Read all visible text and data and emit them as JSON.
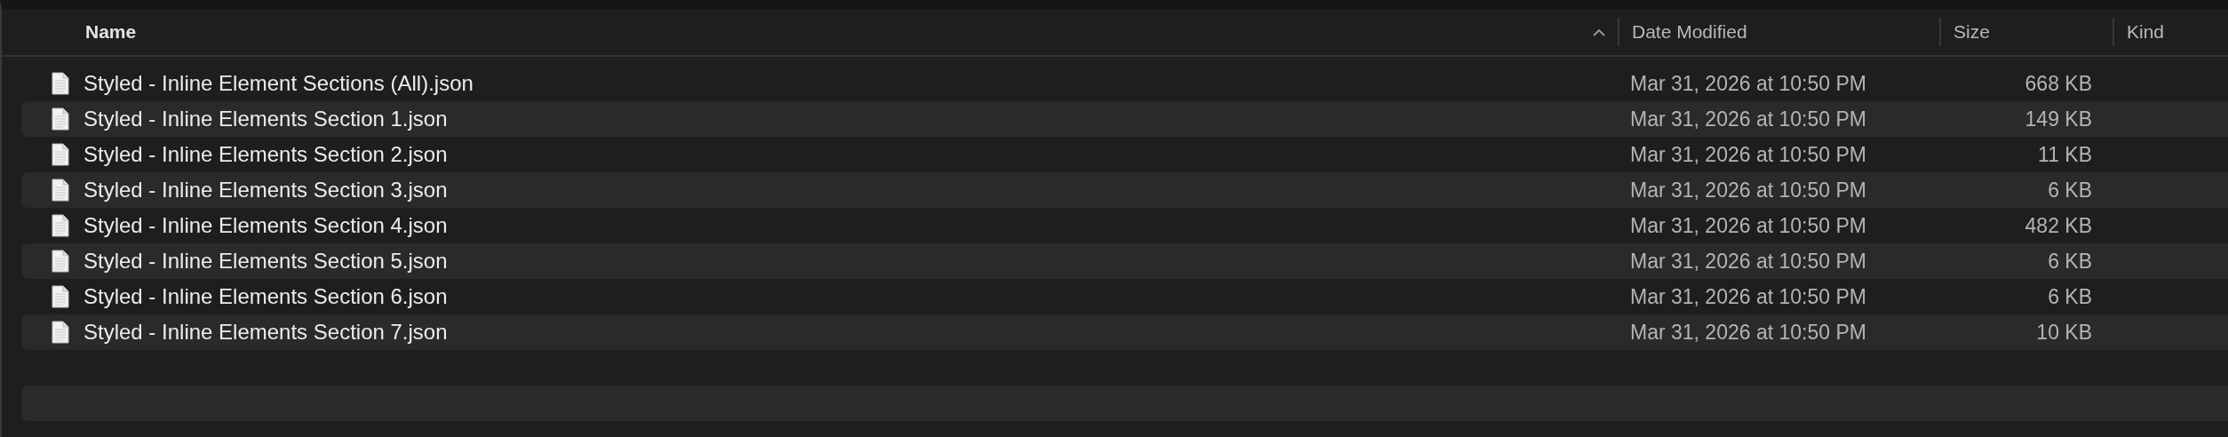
{
  "columns": [
    {
      "label": "Name",
      "sorted": true
    },
    {
      "label": "Date Modified",
      "sorted": false
    },
    {
      "label": "Size",
      "sorted": false
    },
    {
      "label": "Kind",
      "sorted": false
    }
  ],
  "rows": [
    {
      "name": "Styled - Inline Element Sections (All).json",
      "date": "Mar 31, 2026 at 10:50 PM",
      "size": "668 KB"
    },
    {
      "name": "Styled - Inline Elements Section 1.json",
      "date": "Mar 31, 2026 at 10:50 PM",
      "size": "149 KB"
    },
    {
      "name": "Styled - Inline Elements Section 2.json",
      "date": "Mar 31, 2026 at 10:50 PM",
      "size": "11 KB"
    },
    {
      "name": "Styled - Inline Elements Section 3.json",
      "date": "Mar 31, 2026 at 10:50 PM",
      "size": "6 KB"
    },
    {
      "name": "Styled - Inline Elements Section 4.json",
      "date": "Mar 31, 2026 at 10:50 PM",
      "size": "482 KB"
    },
    {
      "name": "Styled - Inline Elements Section 5.json",
      "date": "Mar 31, 2026 at 10:50 PM",
      "size": "6 KB"
    },
    {
      "name": "Styled - Inline Elements Section 6.json",
      "date": "Mar 31, 2026 at 10:50 PM",
      "size": "6 KB"
    },
    {
      "name": "Styled - Inline Elements Section 7.json",
      "date": "Mar 31, 2026 at 10:50 PM",
      "size": "10 KB"
    }
  ]
}
